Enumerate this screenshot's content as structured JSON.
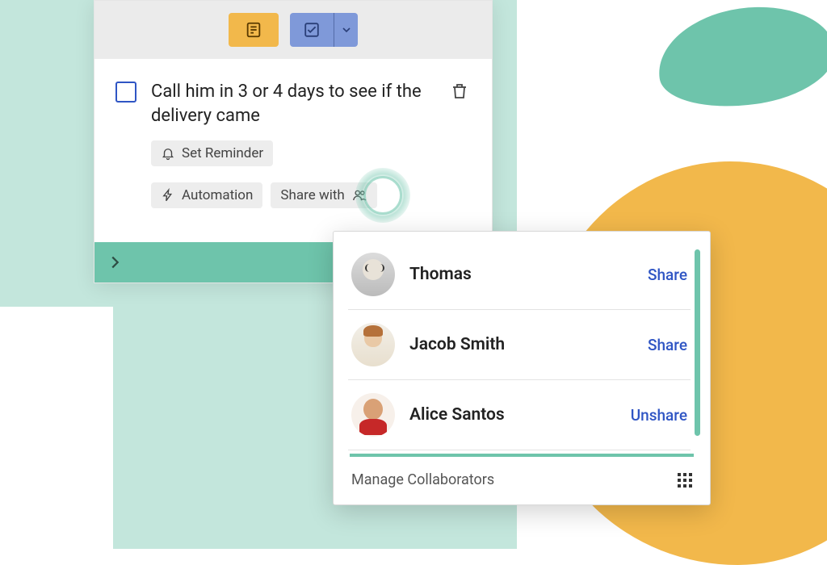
{
  "task": {
    "text": "Call him in 3 or 4 days to see if the delivery came",
    "reminder_label": "Set Reminder",
    "automation_label": "Automation",
    "share_label": "Share with"
  },
  "share_popover": {
    "people": [
      {
        "name": "Thomas",
        "action": "Share"
      },
      {
        "name": "Jacob Smith",
        "action": "Share"
      },
      {
        "name": "Alice Santos",
        "action": "Unshare"
      }
    ],
    "footer_label": "Manage Collaborators"
  },
  "colors": {
    "accent_blue": "#2f55c4",
    "accent_teal": "#6ec4ab",
    "accent_yellow": "#f2b84b"
  }
}
